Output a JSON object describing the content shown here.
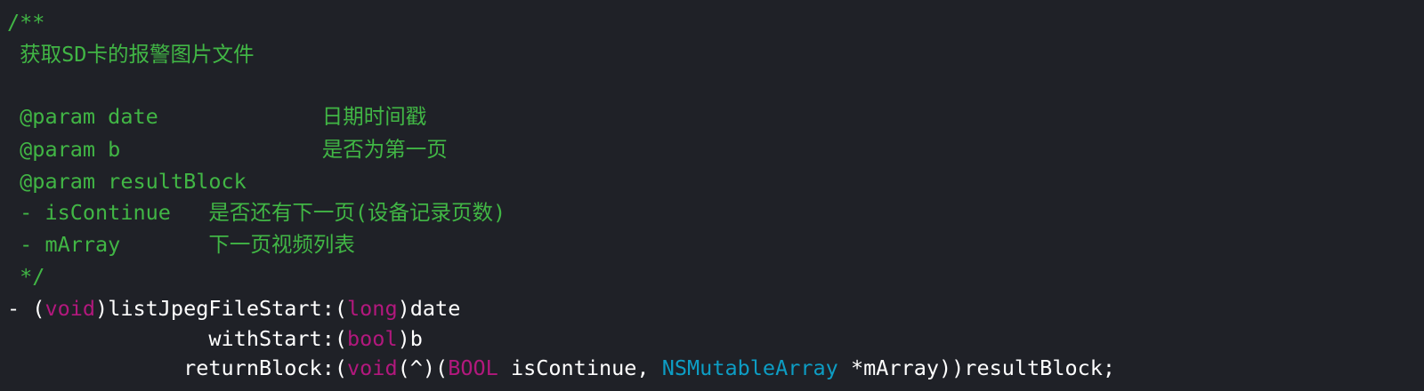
{
  "colors": {
    "background": "#1f2127",
    "comment": "#41b645",
    "plain": "#ffffff",
    "keyword": "#b2187d",
    "type": "#0d9dc4"
  },
  "code": {
    "l01": "/**",
    "l02": " 获取SD卡的报警图片文件",
    "l03": "",
    "l04": " @param date             日期时间戳",
    "l05": " @param b                是否为第一页",
    "l06": " @param resultBlock",
    "l07": " - isContinue   是否还有下一页(设备记录页数)",
    "l08": " - mArray       下一页视频列表",
    "l09": " */",
    "l10": {
      "t1": "- (",
      "t2": "void",
      "t3": ")listJpegFileStart:(",
      "t4": "long",
      "t5": ")date"
    },
    "l11": {
      "t1": "                withStart:(",
      "t2": "bool",
      "t3": ")b"
    },
    "l12": {
      "t1": "              returnBlock:(",
      "t2": "void",
      "t3": "(^)(",
      "t4": "BOOL",
      "t5": " isContinue, ",
      "t6": "NSMutableArray",
      "t7": " *mArray))resultBlock;"
    }
  }
}
